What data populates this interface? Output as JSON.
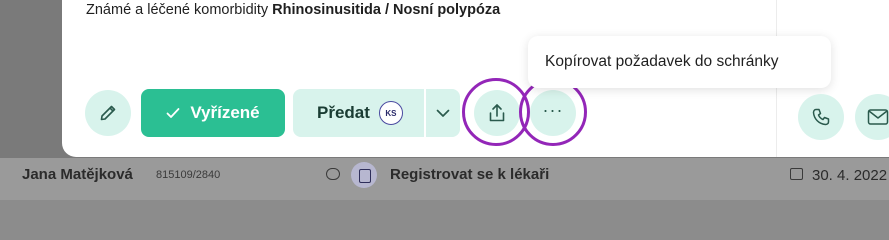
{
  "background_row": {
    "name": "Jana Matějková",
    "code": "815109/2840",
    "task": "Registrovat se k lékaři",
    "date": "30. 4. 2022"
  },
  "card": {
    "comorbidities_prefix": "Známé a léčené komorbidity ",
    "comorbidities_value": "Rhinosinusitida / Nosní polypóza"
  },
  "actions": {
    "edit_icon": "pencil-icon",
    "resolved_label": "Vyřízené",
    "handover_label": "Předat",
    "handover_avatar": "KS",
    "more_label": "···",
    "share_icon": "upload-icon"
  },
  "tooltip": {
    "text": "Kopírovat požadavek do schránky"
  },
  "contact": {
    "phone_icon": "phone-icon",
    "mail_icon": "mail-icon"
  },
  "colors": {
    "accent": "#2bbf93",
    "accent_light": "#d8f3ec",
    "highlight": "#9326b8"
  }
}
